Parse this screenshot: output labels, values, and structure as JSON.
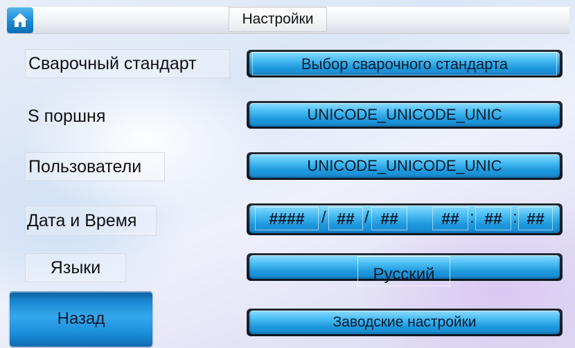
{
  "header": {
    "title": "Настройки",
    "home_icon": "home-icon"
  },
  "rows": {
    "standard": {
      "label": "Сварочный стандарт",
      "value": "Выбор сварочного стандарта"
    },
    "piston": {
      "label": "S поршня",
      "value": "UNICODE_UNICODE_UNIC"
    },
    "users": {
      "label": "Пользователи",
      "value": "UNICODE_UNICODE_UNIC"
    },
    "datetime": {
      "label": "Дата и Время",
      "year": "####",
      "month": "##",
      "day": "##",
      "hour": "##",
      "minute": "##",
      "second": "##",
      "date_sep": "/",
      "time_sep": ":"
    },
    "language": {
      "label": "Языки",
      "value": "Русский"
    },
    "factory": {
      "value": "Заводские настройки"
    }
  },
  "buttons": {
    "back": "Назад"
  },
  "colors": {
    "accent": "#1d97dc",
    "accent_light": "#8fdcff",
    "frame": "#111820"
  }
}
